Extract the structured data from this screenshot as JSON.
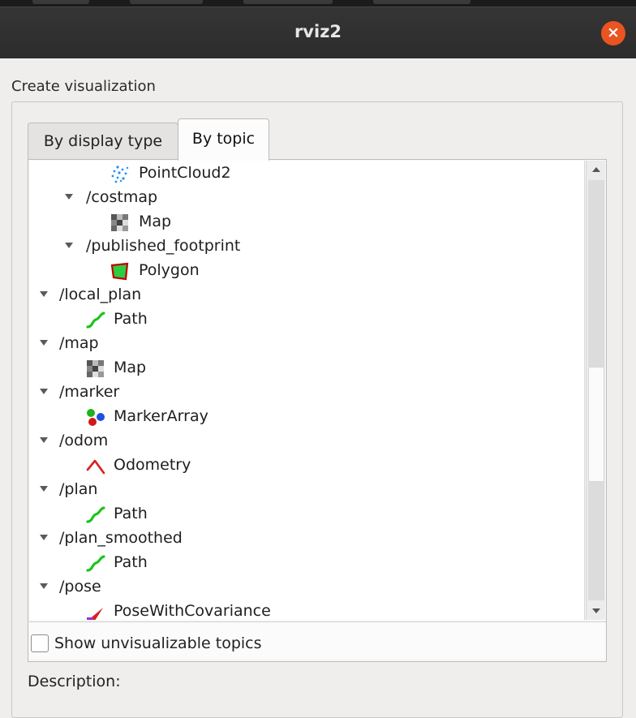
{
  "window": {
    "title": "rviz2"
  },
  "close_glyph": "×",
  "group_label": "Create visualization",
  "tabs": [
    {
      "label": "By display type",
      "active": false
    },
    {
      "label": "By topic",
      "active": true
    }
  ],
  "tree": [
    {
      "label": "PointCloud2",
      "icon": "pointcloud-icon",
      "expandable": false
    },
    {
      "label": "/costmap",
      "icon": "",
      "expandable": true
    },
    {
      "label": "Map",
      "icon": "map-grid-icon",
      "expandable": false
    },
    {
      "label": "/published_footprint",
      "icon": "",
      "expandable": true
    },
    {
      "label": "Polygon",
      "icon": "polygon-icon",
      "expandable": false
    },
    {
      "label": "/local_plan",
      "icon": "",
      "expandable": true
    },
    {
      "label": "Path",
      "icon": "path-icon",
      "expandable": false
    },
    {
      "label": "/map",
      "icon": "",
      "expandable": true
    },
    {
      "label": "Map",
      "icon": "map-grid-icon",
      "expandable": false
    },
    {
      "label": "/marker",
      "icon": "",
      "expandable": true
    },
    {
      "label": "MarkerArray",
      "icon": "marker-array-icon",
      "expandable": false
    },
    {
      "label": "/odom",
      "icon": "",
      "expandable": true
    },
    {
      "label": "Odometry",
      "icon": "odometry-icon",
      "expandable": false
    },
    {
      "label": "/plan",
      "icon": "",
      "expandable": true
    },
    {
      "label": "Path",
      "icon": "path-icon",
      "expandable": false
    },
    {
      "label": "/plan_smoothed",
      "icon": "",
      "expandable": true
    },
    {
      "label": "Path",
      "icon": "path-icon",
      "expandable": false
    },
    {
      "label": "/pose",
      "icon": "",
      "expandable": true
    },
    {
      "label": "PoseWithCovariance",
      "icon": "pose-covariance-icon",
      "expandable": false
    }
  ],
  "show_unvisualizable": {
    "label": "Show unvisualizable topics",
    "checked": false
  },
  "description_label": "Description:"
}
